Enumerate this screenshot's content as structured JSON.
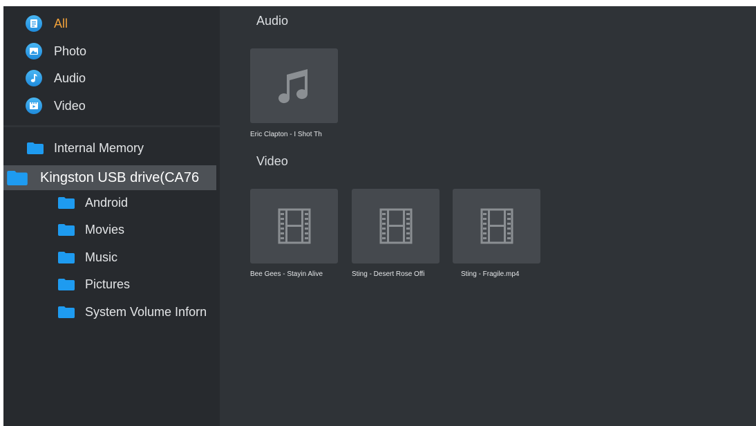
{
  "categories": [
    {
      "label": "All",
      "icon": "document-icon",
      "active": true
    },
    {
      "label": "Photo",
      "icon": "image-icon",
      "active": false
    },
    {
      "label": "Audio",
      "icon": "music-note-icon",
      "active": false
    },
    {
      "label": "Video",
      "icon": "video-icon",
      "active": false
    }
  ],
  "storage": {
    "internal_label": "Internal Memory",
    "drive_label": "Kingston USB drive(CA76",
    "subfolders": [
      "Android",
      "Movies",
      "Music",
      "Pictures",
      "System Volume Inforn"
    ]
  },
  "sections": {
    "audio_title": "Audio",
    "video_title": "Video"
  },
  "audio_files": [
    "Eric Clapton - I Shot Th"
  ],
  "video_files": [
    "Bee Gees - Stayin Alive",
    "Sting - Desert Rose Offi",
    "Sting - Fragile.mp4"
  ],
  "colors": {
    "accent": "#f2a23a",
    "icon_blue": "#2b9ae8",
    "background": "#2f3337",
    "sidebar": "#272a2e",
    "selected_row": "#4d5156",
    "tile": "#45494e"
  }
}
